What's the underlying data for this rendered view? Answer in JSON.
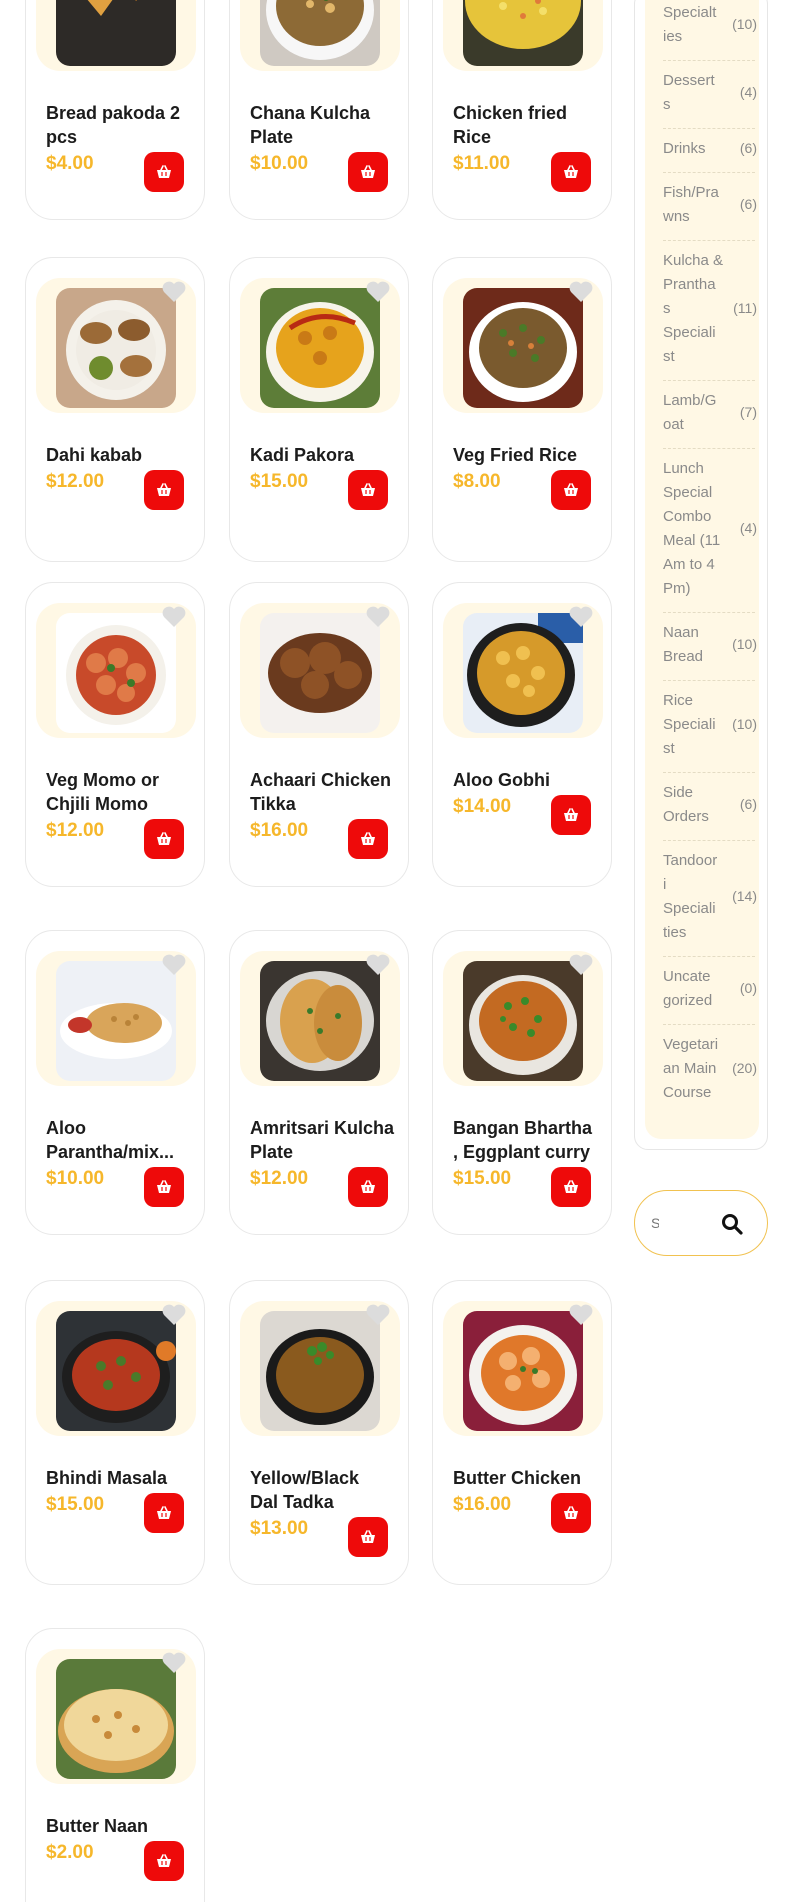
{
  "colors": {
    "accent": "#f6b72b",
    "cart": "#ee0a0a",
    "cream": "#fff8e5"
  },
  "products": [
    {
      "name_line1": "Bread pakoda 2",
      "name_line2": "pcs",
      "price": "$4.00",
      "photo": "bread-pakoda-photo"
    },
    {
      "name_line1": "Chana Kulcha",
      "name_line2": "Plate",
      "price": "$10.00",
      "photo": "chana-kulcha-photo"
    },
    {
      "name_line1": "Chicken fried",
      "name_line2": "Rice",
      "price": "$11.00",
      "photo": "chicken-fried-rice-photo"
    },
    {
      "name_line1": "Dahi kabab",
      "name_line2": "",
      "price": "$12.00",
      "photo": "dahi-kabab-photo"
    },
    {
      "name_line1": "Kadi Pakora",
      "name_line2": "",
      "price": "$15.00",
      "photo": "kadi-pakora-photo"
    },
    {
      "name_line1": "Veg Fried Rice",
      "name_line2": "",
      "price": "$8.00",
      "photo": "veg-fried-rice-photo"
    },
    {
      "name_line1": "Veg Momo or",
      "name_line2": "Chjili Momo",
      "price": "$12.00",
      "photo": "veg-momo-photo"
    },
    {
      "name_line1": "Achaari Chicken",
      "name_line2": "Tikka",
      "price": "$16.00",
      "photo": "achaari-chicken-photo"
    },
    {
      "name_line1": "Aloo Gobhi",
      "name_line2": "",
      "price": "$14.00",
      "photo": "aloo-gobhi-photo"
    },
    {
      "name_line1": "Aloo",
      "name_line2": "Parantha/mix...",
      "price": "$10.00",
      "photo": "aloo-parantha-photo"
    },
    {
      "name_line1": "Amritsari Kulcha",
      "name_line2": "Plate",
      "price": "$12.00",
      "photo": "amritsari-kulcha-photo"
    },
    {
      "name_line1": "Bangan Bhartha",
      "name_line2": ", Eggplant curry",
      "price": "$15.00",
      "photo": "bangan-bhartha-photo"
    },
    {
      "name_line1": "Bhindi Masala",
      "name_line2": "",
      "price": "$15.00",
      "photo": "bhindi-masala-photo"
    },
    {
      "name_line1": "Yellow/Black",
      "name_line2": "Dal Tadka",
      "price": "$13.00",
      "photo": "dal-tadka-photo"
    },
    {
      "name_line1": "Butter Chicken",
      "name_line2": "",
      "price": "$16.00",
      "photo": "butter-chicken-photo"
    },
    {
      "name_line1": "Butter Naan",
      "name_line2": "",
      "price": "$2.00",
      "photo": "butter-naan-photo"
    }
  ],
  "categories": [
    {
      "lines": [
        "Specialt",
        "ies"
      ],
      "count": "(10)"
    },
    {
      "lines": [
        "Dessert",
        "s"
      ],
      "count": "(4)"
    },
    {
      "lines": [
        "Drinks"
      ],
      "count": "(6)"
    },
    {
      "lines": [
        "Fish/Pra",
        "wns"
      ],
      "count": "(6)"
    },
    {
      "lines": [
        "Kulcha &",
        "Prantha",
        "s",
        "Speciali",
        "st"
      ],
      "count": "(11)"
    },
    {
      "lines": [
        "Lamb/G",
        "oat"
      ],
      "count": "(7)"
    },
    {
      "lines": [
        "Lunch",
        "Special",
        "Combo",
        "Meal (11",
        "Am to 4",
        "Pm)"
      ],
      "count": "(4)"
    },
    {
      "lines": [
        "Naan",
        "Bread"
      ],
      "count": "(10)"
    },
    {
      "lines": [
        "Rice",
        "Speciali",
        "st"
      ],
      "count": "(10)"
    },
    {
      "lines": [
        "Side",
        "Orders"
      ],
      "count": "(6)"
    },
    {
      "lines": [
        "Tandoor",
        "i",
        "Speciali",
        "ties"
      ],
      "count": "(14)"
    },
    {
      "lines": [
        "Uncate",
        "gorized"
      ],
      "count": "(0)"
    },
    {
      "lines": [
        "Vegetari",
        "an Main",
        "Course"
      ],
      "count": "(20)"
    }
  ],
  "search": {
    "placeholder": "Search"
  },
  "icons": {
    "wishlist": "heart-icon",
    "cart": "basket-icon",
    "search": "search-icon"
  }
}
